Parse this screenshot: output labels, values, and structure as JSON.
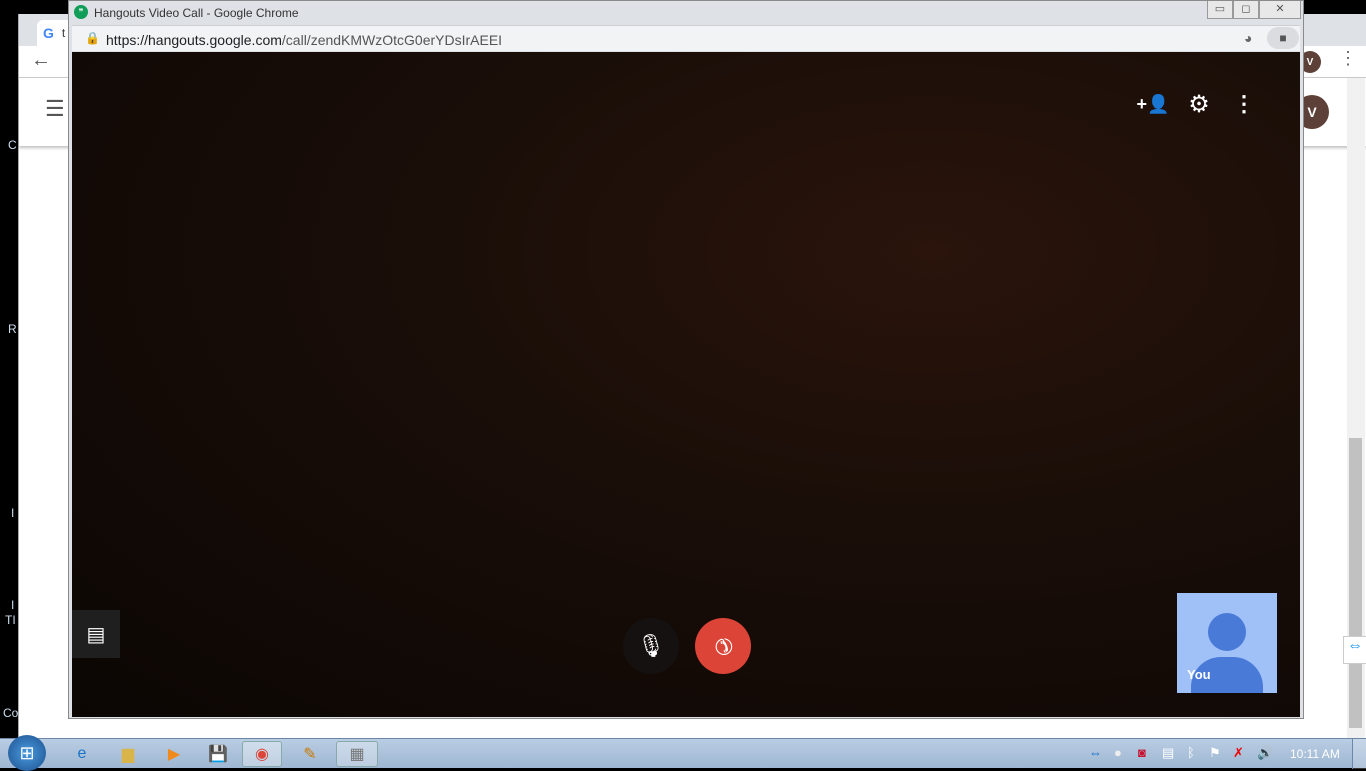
{
  "background_window": {
    "tab_partial": "t",
    "avatar": "V",
    "side_letters": [
      "C",
      "R",
      "I",
      "I",
      "TI",
      "Co"
    ]
  },
  "popup": {
    "title": "Hangouts Video Call - Google Chrome",
    "url_host": "https://hangouts.google.com",
    "url_path": "/call/zendKMWzOtcG0erYDsIrAEEI",
    "window_controls": {
      "minimize": "▭",
      "restore": "◻",
      "close": "✕"
    }
  },
  "call": {
    "self_label": "You",
    "hangup_color": "#db4437",
    "self_tile_color": "#a0c0f8",
    "self_avatar_color": "#4a7ad8"
  },
  "taskbar": {
    "clock": "10:11 AM"
  }
}
